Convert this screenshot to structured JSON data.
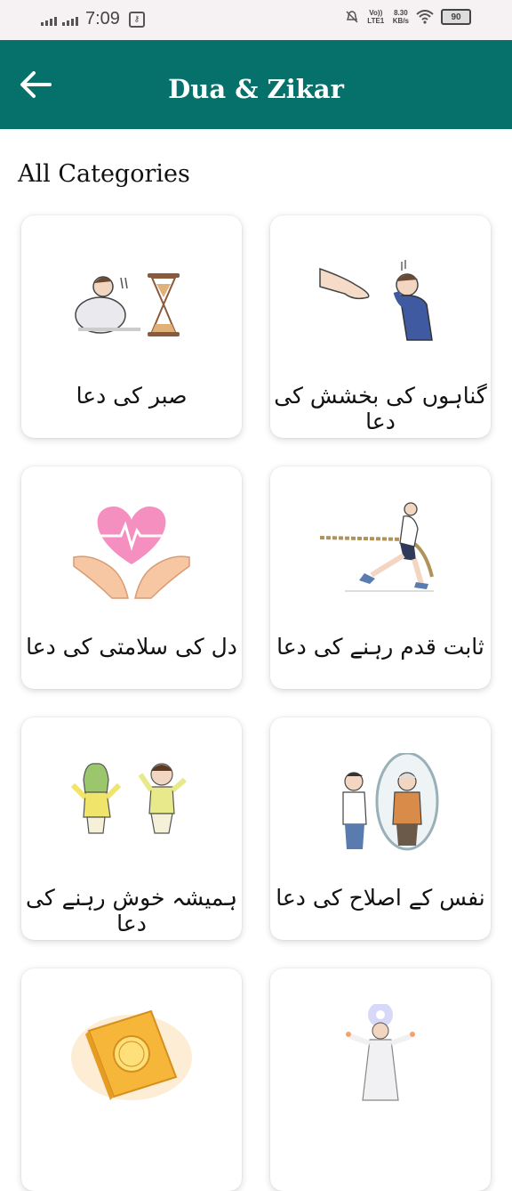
{
  "status_bar": {
    "time": "7:09",
    "net_label_1": "Vo)) LTE1",
    "speed_value": "8.30",
    "speed_unit": "KB/s",
    "battery": "90"
  },
  "app_bar": {
    "title": "Dua & Zikar",
    "back_icon": "arrow-left-icon"
  },
  "section_title": "All Categories",
  "categories": [
    {
      "label": "صبر کی دعا",
      "icon": "patience-man-hourglass-illustration"
    },
    {
      "label": "گناہوں کی بخشش کی دعا",
      "icon": "repentant-man-hand-illustration"
    },
    {
      "label": "دل کی سلامتی کی دعا",
      "icon": "heart-in-hands-illustration"
    },
    {
      "label": "ثابت قدم رہنے کی دعا",
      "icon": "tug-of-war-man-illustration"
    },
    {
      "label": "ہمیشہ خوش رہنے کی دعا",
      "icon": "happy-children-jumping-illustration"
    },
    {
      "label": "نفس کے اصلاح کی دعا",
      "icon": "man-mirror-reflection-illustration"
    },
    {
      "label": "",
      "icon": "quran-book-illustration"
    },
    {
      "label": "",
      "icon": "praying-figure-light-illustration"
    }
  ],
  "colors": {
    "app_bar": "#06716a",
    "status_bar": "#f6f2f4"
  }
}
